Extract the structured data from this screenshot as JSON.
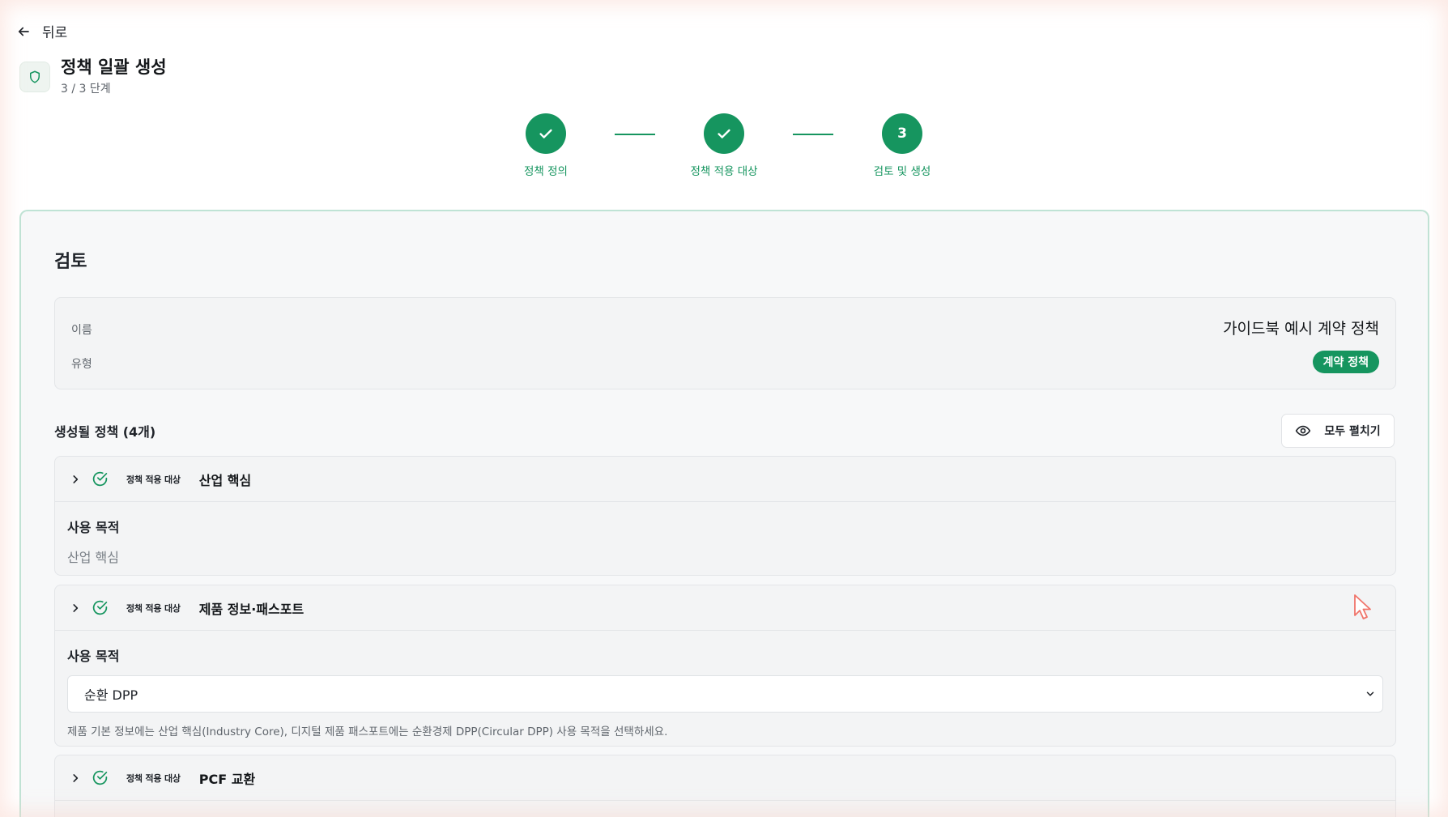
{
  "nav": {
    "back_label": "뒤로"
  },
  "header": {
    "title": "정책 일괄 생성",
    "subtitle": "3 / 3 단계"
  },
  "steps": [
    {
      "label": "정책 정의",
      "state": "done"
    },
    {
      "label": "정책 적용 대상",
      "state": "done"
    },
    {
      "label": "검토 및 생성",
      "state": "current",
      "number": "3"
    }
  ],
  "review": {
    "title": "검토",
    "name_label": "이름",
    "name_value": "가이드북 예시 계약 정책",
    "type_label": "유형",
    "type_value": "계약 정책"
  },
  "policies_section": {
    "title": "생성될 정책 (4개)",
    "expand_all_label": "모두 펼치기",
    "items": [
      {
        "tag": "정책 적용 대상",
        "name": "산업 핵심",
        "purpose_label": "사용 목적",
        "purpose_value": "산업 핵심"
      },
      {
        "tag": "정책 적용 대상",
        "name": "제품 정보·패스포트",
        "purpose_label": "사용 목적",
        "select_value": "순환 DPP",
        "hint": "제품 기본 정보에는 산업 핵심(Industry Core), 디지털 제품 패스포트에는 순환경제 DPP(Circular DPP) 사용 목적을 선택하세요."
      },
      {
        "tag": "정책 적용 대상",
        "name": "PCF 교환"
      }
    ]
  },
  "colors": {
    "accent": "#16955f",
    "card_border": "#bfe3d5",
    "panel_bg": "#f3f4f5"
  },
  "icons": [
    "arrow-left-icon",
    "shield-icon",
    "check-icon",
    "eye-icon",
    "chevron-right-icon",
    "check-circle-icon",
    "chevron-down-icon",
    "cursor-icon"
  ]
}
